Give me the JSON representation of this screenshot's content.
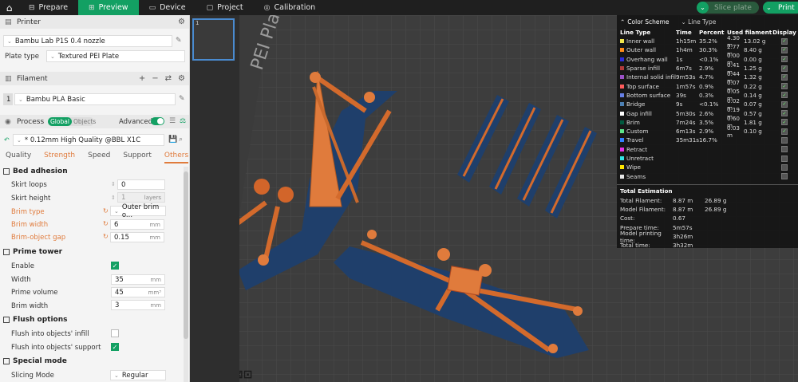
{
  "topbar": {
    "tabs": [
      {
        "label": "Prepare",
        "icon": "prepare-icon"
      },
      {
        "label": "Preview",
        "icon": "preview-icon",
        "active": true
      },
      {
        "label": "Device",
        "icon": "device-icon"
      },
      {
        "label": "Project",
        "icon": "project-icon"
      },
      {
        "label": "Calibration",
        "icon": "calibration-icon"
      }
    ],
    "slice_label": "Slice plate",
    "print_label": "Print"
  },
  "printer": {
    "section_label": "Printer",
    "printer_name": "Bambu Lab P1S 0.4 nozzle",
    "plate_type_label": "Plate type",
    "plate_type_value": "Textured PEI Plate"
  },
  "filament": {
    "section_label": "Filament",
    "slot": "1",
    "name": "Bambu PLA Basic"
  },
  "process": {
    "section_label": "Process",
    "global_label": "Global",
    "objects_label": "Objects",
    "advanced_label": "Advanced",
    "profile": "* 0.12mm High Quality @BBL X1C",
    "tabs": [
      "Quality",
      "Strength",
      "Speed",
      "Support",
      "Others"
    ],
    "active_tab": "Others"
  },
  "settings": {
    "bed_adhesion": {
      "title": "Bed adhesion",
      "skirt_loops_label": "Skirt loops",
      "skirt_loops_value": "0",
      "skirt_height_label": "Skirt height",
      "skirt_height_value": "1",
      "skirt_height_unit": "layers",
      "brim_type_label": "Brim type",
      "brim_type_value": "Outer brim o...",
      "brim_width_label": "Brim width",
      "brim_width_value": "6",
      "brim_width_unit": "mm",
      "brim_gap_label": "Brim-object gap",
      "brim_gap_value": "0.15",
      "brim_gap_unit": "mm"
    },
    "prime_tower": {
      "title": "Prime tower",
      "enable_label": "Enable",
      "width_label": "Width",
      "width_value": "35",
      "width_unit": "mm",
      "volume_label": "Prime volume",
      "volume_value": "45",
      "volume_unit": "mm³",
      "brim_width_label": "Brim width",
      "brim_width_value": "3",
      "brim_width_unit": "mm"
    },
    "flush": {
      "title": "Flush options",
      "infill_label": "Flush into objects' infill",
      "support_label": "Flush into objects' support"
    },
    "special": {
      "title": "Special mode",
      "slicing_mode_label": "Slicing Mode",
      "slicing_mode_value": "Regular"
    }
  },
  "viewport": {
    "plate_number": "1",
    "bed_text": "PEI Plate"
  },
  "legend": {
    "color_scheme_label": "Color Scheme",
    "line_type_label": "Line Type",
    "columns": [
      "Line Type",
      "Time",
      "Percent",
      "Used filament",
      "Display"
    ],
    "rows": [
      {
        "name": "Inner wall",
        "color": "#f2e64d",
        "time": "1h15m",
        "percent": "35.2%",
        "len": "4.30 m",
        "weight": "13.02 g",
        "display": true
      },
      {
        "name": "Outer wall",
        "color": "#ff8c1a",
        "time": "1h4m",
        "percent": "30.3%",
        "len": "2.77 m",
        "weight": "8.40 g",
        "display": true
      },
      {
        "name": "Overhang wall",
        "color": "#2d2dd9",
        "time": "1s",
        "percent": "<0.1%",
        "len": "0.00 m",
        "weight": "0.00 g",
        "display": true
      },
      {
        "name": "Sparse infill",
        "color": "#b33a3a",
        "time": "6m7s",
        "percent": "2.9%",
        "len": "0.41 m",
        "weight": "1.25 g",
        "display": true
      },
      {
        "name": "Internal solid infill",
        "color": "#9c52c7",
        "time": "9m53s",
        "percent": "4.7%",
        "len": "0.44 m",
        "weight": "1.32 g",
        "display": true
      },
      {
        "name": "Top surface",
        "color": "#ff5c5c",
        "time": "1m57s",
        "percent": "0.9%",
        "len": "0.07 m",
        "weight": "0.22 g",
        "display": true
      },
      {
        "name": "Bottom surface",
        "color": "#6680e6",
        "time": "39s",
        "percent": "0.3%",
        "len": "0.05 m",
        "weight": "0.14 g",
        "display": true
      },
      {
        "name": "Bridge",
        "color": "#4d80b3",
        "time": "9s",
        "percent": "<0.1%",
        "len": "0.02 m",
        "weight": "0.07 g",
        "display": true
      },
      {
        "name": "Gap infill",
        "color": "#ffffff",
        "time": "5m30s",
        "percent": "2.6%",
        "len": "0.19 m",
        "weight": "0.57 g",
        "display": true
      },
      {
        "name": "Brim",
        "color": "#00593e",
        "time": "7m24s",
        "percent": "3.5%",
        "len": "0.60 m",
        "weight": "1.81 g",
        "display": true
      },
      {
        "name": "Custom",
        "color": "#5ee68a",
        "time": "6m13s",
        "percent": "2.9%",
        "len": "0.03 m",
        "weight": "0.10 g",
        "display": true
      },
      {
        "name": "Travel",
        "color": "#3380ff",
        "time": "35m31s",
        "percent": "16.7%",
        "len": "",
        "weight": "",
        "display": false
      },
      {
        "name": "Retract",
        "color": "#e633e6",
        "time": "",
        "percent": "",
        "len": "",
        "weight": "",
        "display": false
      },
      {
        "name": "Unretract",
        "color": "#33e6e6",
        "time": "",
        "percent": "",
        "len": "",
        "weight": "",
        "display": false
      },
      {
        "name": "Wipe",
        "color": "#ffe600",
        "time": "",
        "percent": "",
        "len": "",
        "weight": "",
        "display": false
      },
      {
        "name": "Seams",
        "color": "#e6e6e6",
        "time": "",
        "percent": "",
        "len": "",
        "weight": "",
        "display": false
      }
    ],
    "estimation_title": "Total Estimation",
    "estimation": [
      {
        "label": "Total Filament:",
        "a": "8.87 m",
        "b": "26.89 g"
      },
      {
        "label": "Model Filament:",
        "a": "8.87 m",
        "b": "26.89 g"
      },
      {
        "label": "Cost:",
        "a": "0.67",
        "b": ""
      },
      {
        "label": "Prepare time:",
        "a": "5m57s",
        "b": ""
      },
      {
        "label": "Model printing time:",
        "a": "3h26m",
        "b": ""
      },
      {
        "label": "Total time:",
        "a": "3h32m",
        "b": ""
      }
    ]
  }
}
